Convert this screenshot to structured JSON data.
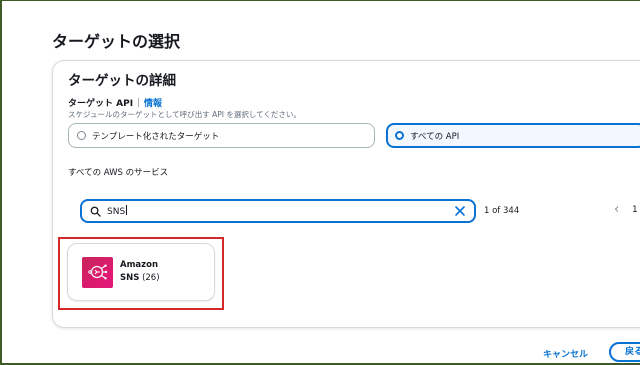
{
  "page": {
    "title": "ターゲットの選択"
  },
  "details": {
    "title": "ターゲットの詳細",
    "api_label": "ターゲット API",
    "info_link": "情報",
    "description": "スケジュールのターゲットとして呼び出す API を選択してください。",
    "options": [
      {
        "label": "テンプレート化されたターゲット",
        "selected": false
      },
      {
        "label": "すべての API",
        "selected": true
      }
    ]
  },
  "services": {
    "label": "すべての AWS のサービス",
    "search_value": "SNS",
    "result_count": "1 of 344",
    "page_prev": "‹",
    "page_number": "1"
  },
  "result_card": {
    "title": "Amazon",
    "service": "SNS",
    "count": "(26)",
    "icon": "sns-icon",
    "icon_color": "#e7157b"
  },
  "footer": {
    "cancel_label": "キャンセル",
    "back_label": "戻る"
  },
  "colors": {
    "accent": "#0972d3",
    "highlight": "#d62828",
    "frame": "#3f5a26"
  }
}
